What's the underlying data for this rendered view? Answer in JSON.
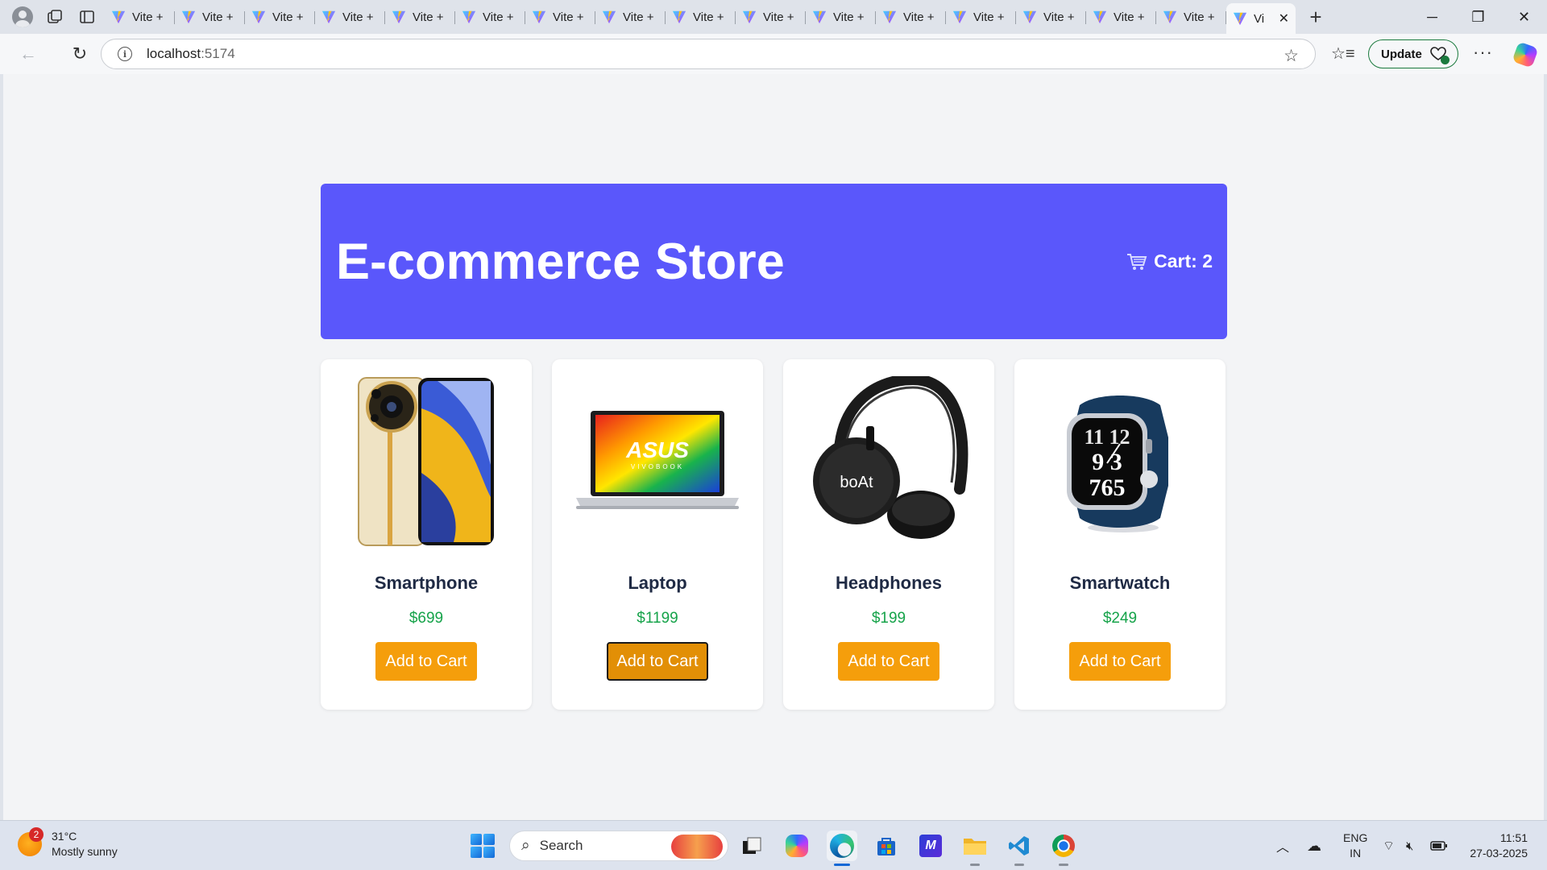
{
  "browser": {
    "tabs": [
      {
        "label": "Vite +"
      },
      {
        "label": "Vite +"
      },
      {
        "label": "Vite +"
      },
      {
        "label": "Vite +"
      },
      {
        "label": "Vite +"
      },
      {
        "label": "Vite +"
      },
      {
        "label": "Vite +"
      },
      {
        "label": "Vite +"
      },
      {
        "label": "Vite +"
      },
      {
        "label": "Vite +"
      },
      {
        "label": "Vite +"
      },
      {
        "label": "Vite +"
      },
      {
        "label": "Vite +"
      },
      {
        "label": "Vite +"
      },
      {
        "label": "Vite +"
      },
      {
        "label": "Vite +"
      }
    ],
    "active_tab": {
      "label": "Vi"
    },
    "url_host": "localhost",
    "url_port": ":5174",
    "update_label": "Update"
  },
  "store": {
    "title": "E-commerce Store",
    "cart_label": "Cart: 2",
    "products": [
      {
        "name": "Smartphone",
        "price": "$699",
        "button": "Add to Cart"
      },
      {
        "name": "Laptop",
        "price": "$1199",
        "button": "Add to Cart"
      },
      {
        "name": "Headphones",
        "price": "$199",
        "button": "Add to Cart"
      },
      {
        "name": "Smartwatch",
        "price": "$249",
        "button": "Add to Cart"
      }
    ],
    "laptop_brand": "ASUS",
    "laptop_sub": "VIVOBOOK",
    "headphone_brand": "boAt",
    "watch_face": "11 12 1 9 3 7 6 5"
  },
  "colors": {
    "header_bg": "#5a57fb",
    "button_bg": "#f59e0b",
    "price_text": "#16a34a",
    "page_bg": "#f3f4f6"
  },
  "taskbar": {
    "weather_badge": "2",
    "temperature": "31°C",
    "condition": "Mostly sunny",
    "search_label": "Search",
    "lang_line1": "ENG",
    "lang_line2": "IN",
    "time": "11:51",
    "date": "27-03-2025"
  }
}
